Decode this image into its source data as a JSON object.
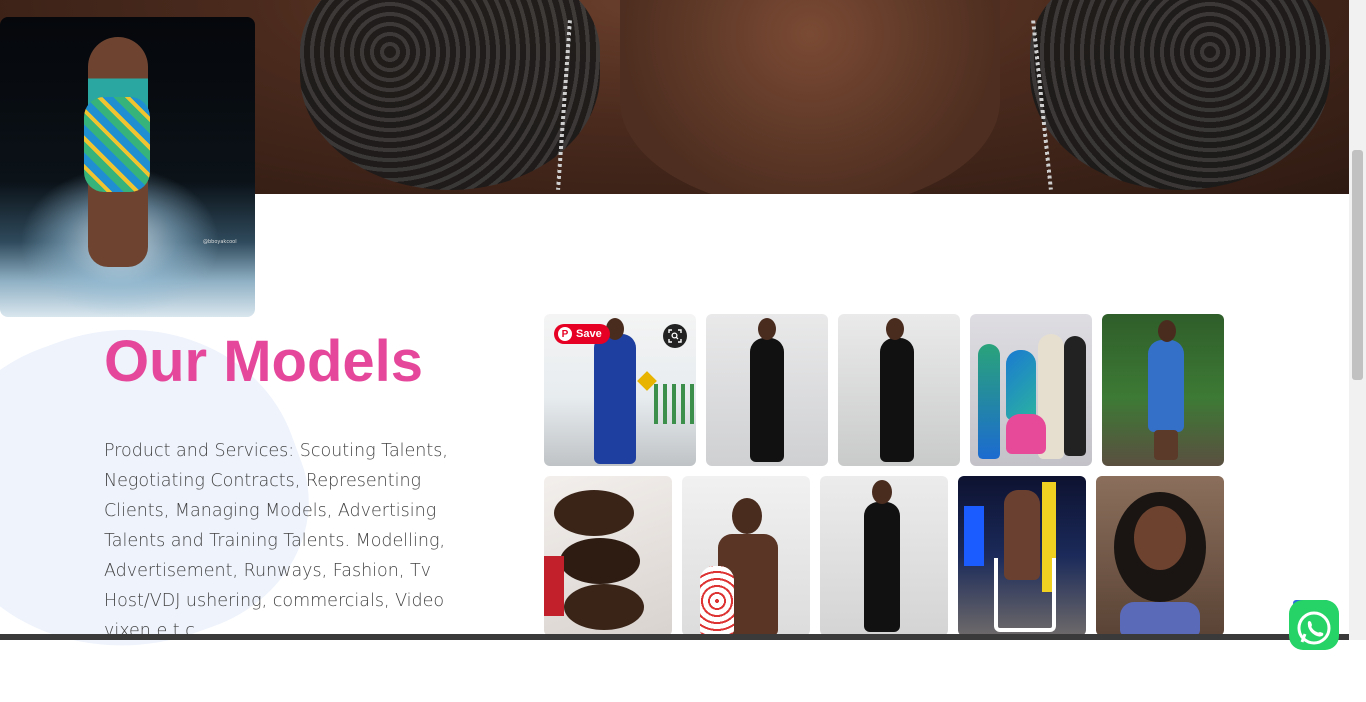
{
  "section": {
    "title": "Our Models",
    "description": "Product and Services: Scouting Talents, Negotiating Contracts, Representing Clients, Managing Models, Advertising Talents and Training Talents. Modelling, Advertisement, Runways, Fashion, Tv Host/VDJ ushering, commercials, Video vixen e.t.c"
  },
  "gallery": {
    "save_label": "Save",
    "save_icon": "pinterest-icon",
    "lens_icon": "visual-search-icon",
    "tiles": [
      "model-photo-blue-suit",
      "model-photo-black-outfit",
      "model-photo-black-crop",
      "model-photo-group",
      "model-photo-blue-dress",
      "model-photo-three-faces",
      "model-photo-male",
      "model-photo-black-crop-2",
      "model-photo-chair-night",
      "model-photo-braids-portrait"
    ]
  },
  "float_photo": {
    "watermark": "@bboyakcool"
  },
  "widgets": {
    "whatsapp_icon": "whatsapp-icon"
  },
  "colors": {
    "title": "#e5489a",
    "save_button": "#e60023",
    "whatsapp": "#25d366"
  }
}
